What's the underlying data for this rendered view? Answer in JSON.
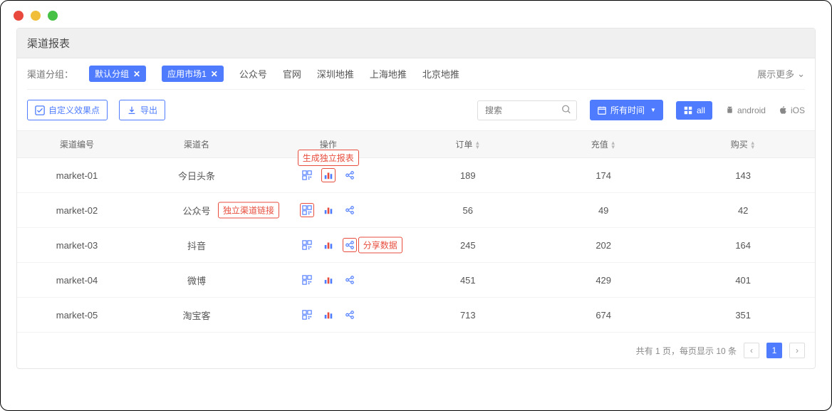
{
  "header": {
    "title": "渠道报表"
  },
  "filters": {
    "label": "渠道分组：",
    "active_tags": [
      "默认分组",
      "应用市场1"
    ],
    "items": [
      "公众号",
      "官网",
      "深圳地推",
      "上海地推",
      "北京地推"
    ],
    "more_label": "展示更多"
  },
  "toolbar": {
    "custom_btn": "自定义效果点",
    "export_btn": "导出",
    "search_placeholder": "搜索",
    "time_btn": "所有时间",
    "all_btn": "all",
    "os_android": "android",
    "os_ios": "iOS"
  },
  "table": {
    "columns": [
      "渠道编号",
      "渠道名",
      "操作",
      "订单",
      "充值",
      "购买"
    ],
    "rows": [
      {
        "id": "market-01",
        "name": "今日头条",
        "orders": 189,
        "recharge": 174,
        "buy": 143
      },
      {
        "id": "market-02",
        "name": "公众号",
        "orders": 56,
        "recharge": 49,
        "buy": 42
      },
      {
        "id": "market-03",
        "name": "抖音",
        "orders": 245,
        "recharge": 202,
        "buy": 164
      },
      {
        "id": "market-04",
        "name": "微博",
        "orders": 451,
        "recharge": 429,
        "buy": 401
      },
      {
        "id": "market-05",
        "name": "淘宝客",
        "orders": 713,
        "recharge": 674,
        "buy": 351
      }
    ]
  },
  "callouts": {
    "report": "生成独立报表",
    "link": "独立渠道链接",
    "share": "分享数据"
  },
  "pagination": {
    "text": "共有 1 页，每页显示 10 条",
    "current": "1"
  }
}
